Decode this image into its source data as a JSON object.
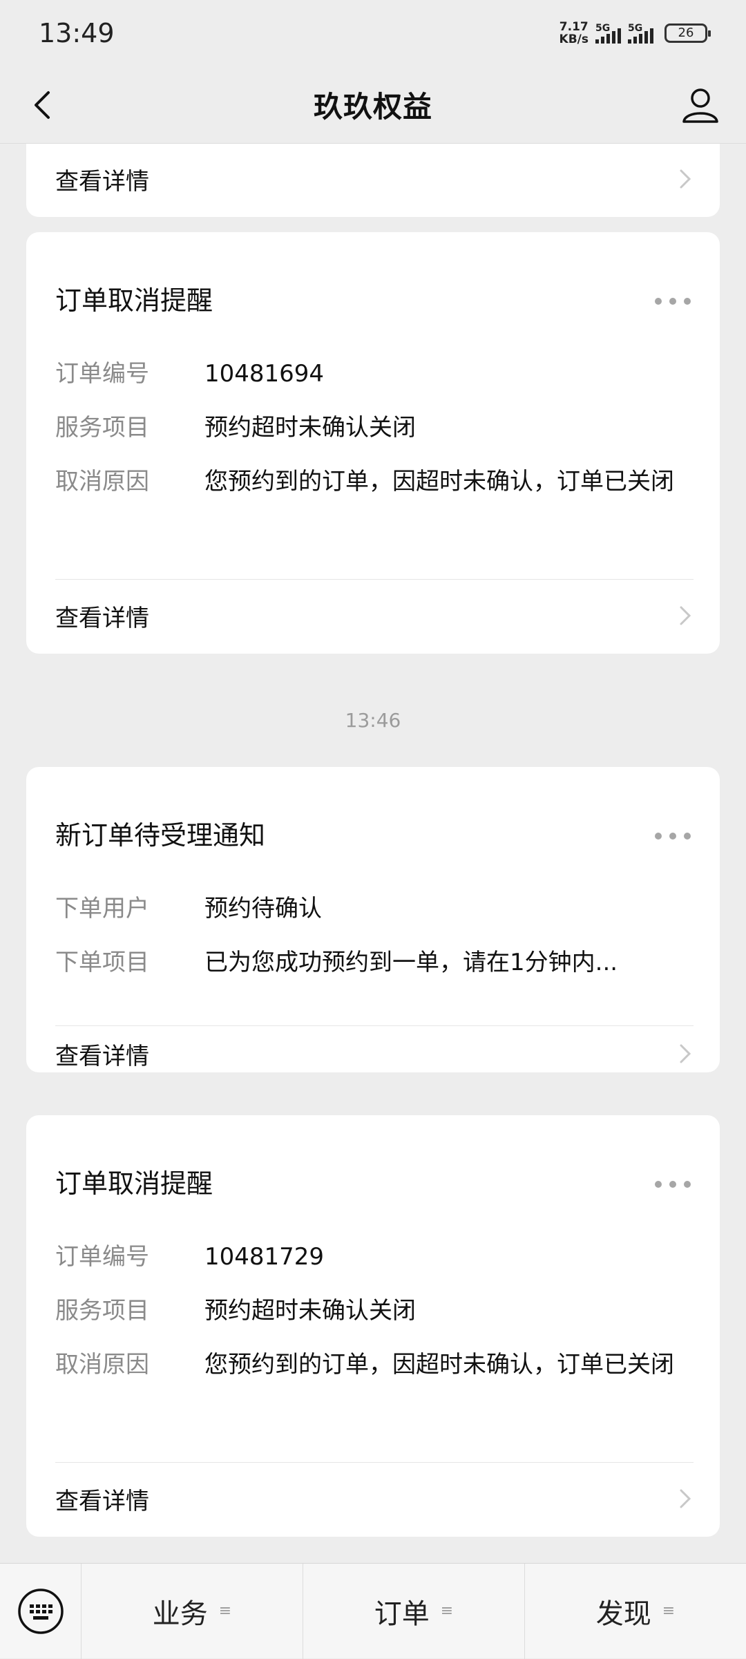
{
  "status_bar": {
    "time": "13:49",
    "net_speed_top": "7.17",
    "net_speed_bottom": "KB/s",
    "signal1_label": "5G",
    "signal2_label": "5G",
    "battery": "26"
  },
  "nav": {
    "title": "玖玖权益"
  },
  "cards": {
    "top_partial": {
      "detail_label": "查看详情"
    },
    "cancel1": {
      "title": "订单取消提醒",
      "rows": [
        {
          "key": "订单编号",
          "value": "10481694"
        },
        {
          "key": "服务项目",
          "value": "预约超时未确认关闭"
        },
        {
          "key": "取消原因",
          "value": "您预约到的订单，因超时未确认，订单已关闭"
        }
      ],
      "detail_label": "查看详情"
    },
    "timestamp": "13:46",
    "new_order": {
      "title": "新订单待受理通知",
      "rows": [
        {
          "key": "下单用户",
          "value": "预约待确认"
        },
        {
          "key": "下单项目",
          "value": "已为您成功预约到一单，请在1分钟内..."
        }
      ],
      "detail_label": "查看详情"
    },
    "cancel2": {
      "title": "订单取消提醒",
      "rows": [
        {
          "key": "订单编号",
          "value": "10481729"
        },
        {
          "key": "服务项目",
          "value": "预约超时未确认关闭"
        },
        {
          "key": "取消原因",
          "value": "您预约到的订单，因超时未确认，订单已关闭"
        }
      ],
      "detail_label": "查看详情"
    }
  },
  "bottom_menu": {
    "items": [
      {
        "label": "业务"
      },
      {
        "label": "订单"
      },
      {
        "label": "发现"
      }
    ]
  },
  "icons": {
    "back": "back-arrow-icon",
    "profile": "person-icon",
    "more": "more-dots-icon",
    "chevron": "chevron-right-icon",
    "keyboard": "keyboard-icon",
    "menu_lines": "menu-lines-icon"
  }
}
